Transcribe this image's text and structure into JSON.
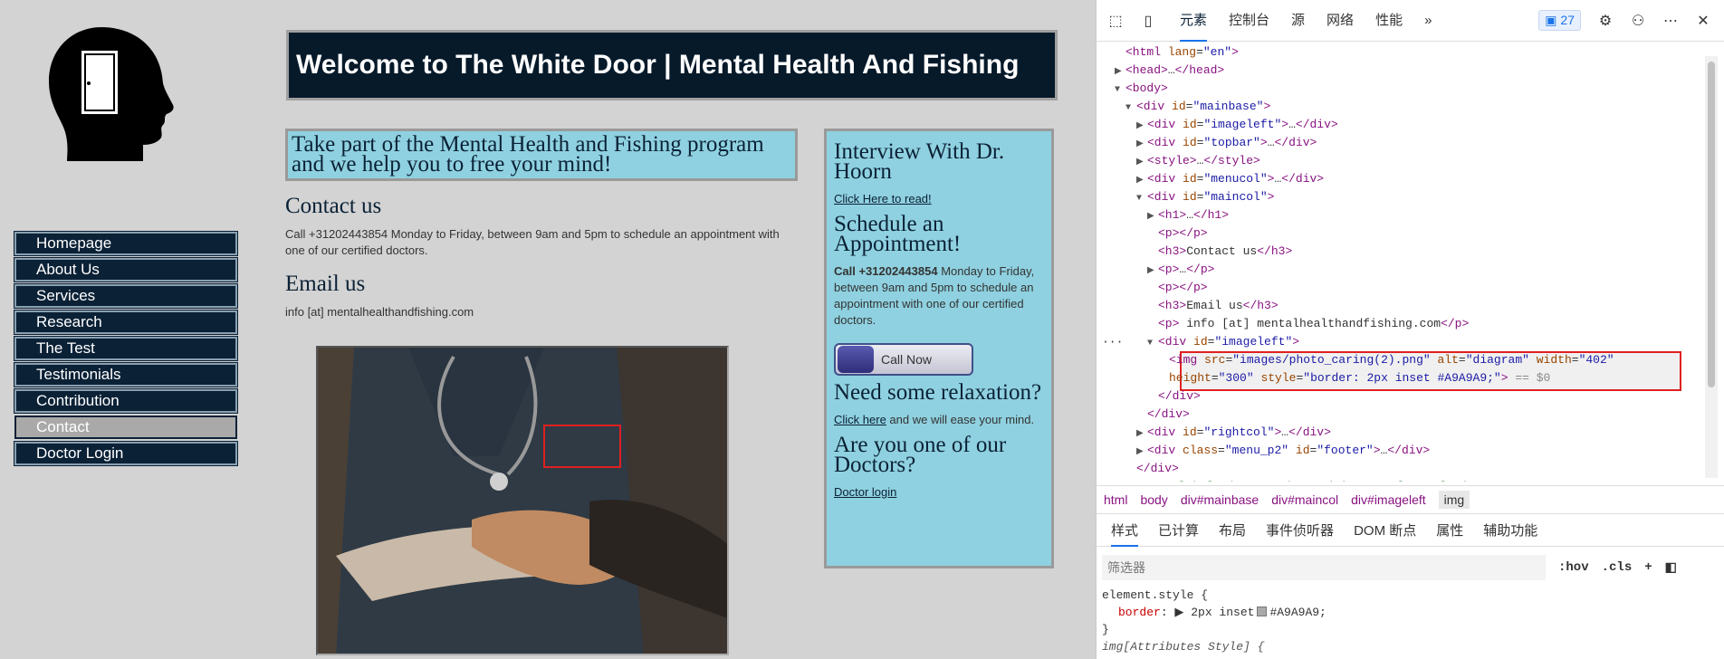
{
  "page": {
    "banner_title": "Welcome to The White Door | Mental Health And Fishing",
    "menu": [
      {
        "label": "Homepage"
      },
      {
        "label": "About Us"
      },
      {
        "label": "Services"
      },
      {
        "label": "Research"
      },
      {
        "label": "The Test"
      },
      {
        "label": "Testimonials"
      },
      {
        "label": "Contribution"
      },
      {
        "label": "Contact",
        "active": true
      },
      {
        "label": "Doctor Login"
      }
    ],
    "intro": "Take part of the Mental Health and Fishing program and we help you to free your mind!",
    "contact_heading": "Contact us",
    "contact_text": "Call +31202443854 Monday to Friday, between 9am and 5pm to schedule an appointment with one of our certified doctors.",
    "email_heading": "Email us",
    "email_text": "info [at] mentalhealthandfishing.com",
    "right": {
      "interview_heading": "Interview With Dr. Hoorn",
      "interview_link": "Click Here to read!",
      "schedule_heading": "Schedule an Appointment!",
      "schedule_phone": "Call +31202443854",
      "schedule_text": " Monday to Friday, between 9am and 5pm to schedule an appointment with one of our certified doctors.",
      "call_now": "Call Now",
      "relax_heading": "Need some relaxation?",
      "relax_link": "Click here",
      "relax_text": " and we will ease your mind.",
      "doctors_heading": "Are you one of our Doctors?",
      "doctors_link": "Doctor login"
    }
  },
  "devtools": {
    "tabs": [
      "元素",
      "控制台",
      "源",
      "网络",
      "性能"
    ],
    "more": "»",
    "issues_count": "27",
    "dom_lines": [
      {
        "indent": 1,
        "html": "<span class='tag'>&lt;html</span> <span class='at'>lang</span>=<span class='av'>\"en\"</span><span class='tag'>&gt;</span>"
      },
      {
        "indent": 1,
        "arrow": "▶",
        "html": "<span class='tag'>&lt;head&gt;</span>…<span class='tag'>&lt;/head&gt;</span>"
      },
      {
        "indent": 1,
        "arrow": "▼",
        "html": "<span class='tag'>&lt;body&gt;</span>"
      },
      {
        "indent": 2,
        "arrow": "▼",
        "html": "<span class='tag'>&lt;div</span> <span class='at'>id</span>=<span class='av'>\"mainbase\"</span><span class='tag'>&gt;</span>"
      },
      {
        "indent": 3,
        "arrow": "▶",
        "html": "<span class='tag'>&lt;div</span> <span class='at'>id</span>=<span class='av'>\"imageleft\"</span><span class='tag'>&gt;</span>…<span class='tag'>&lt;/div&gt;</span>"
      },
      {
        "indent": 3,
        "arrow": "▶",
        "html": "<span class='tag'>&lt;div</span> <span class='at'>id</span>=<span class='av'>\"topbar\"</span><span class='tag'>&gt;</span>…<span class='tag'>&lt;/div&gt;</span>"
      },
      {
        "indent": 3,
        "arrow": "▶",
        "html": "<span class='tag'>&lt;style&gt;</span>…<span class='tag'>&lt;/style&gt;</span>"
      },
      {
        "indent": 3,
        "arrow": "▶",
        "html": "<span class='tag'>&lt;div</span> <span class='at'>id</span>=<span class='av'>\"menucol\"</span><span class='tag'>&gt;</span>…<span class='tag'>&lt;/div&gt;</span>"
      },
      {
        "indent": 3,
        "arrow": "▼",
        "html": "<span class='tag'>&lt;div</span> <span class='at'>id</span>=<span class='av'>\"maincol\"</span><span class='tag'>&gt;</span>"
      },
      {
        "indent": 4,
        "arrow": "▶",
        "html": "<span class='tag'>&lt;h1&gt;</span>…<span class='tag'>&lt;/h1&gt;</span>"
      },
      {
        "indent": 4,
        "html": "<span class='tag'>&lt;p&gt;&lt;/p&gt;</span>"
      },
      {
        "indent": 4,
        "html": "<span class='tag'>&lt;h3&gt;</span>Contact us<span class='tag'>&lt;/h3&gt;</span>"
      },
      {
        "indent": 4,
        "arrow": "▶",
        "html": "<span class='tag'>&lt;p&gt;</span>…<span class='tag'>&lt;/p&gt;</span>"
      },
      {
        "indent": 4,
        "html": "<span class='tag'>&lt;p&gt;&lt;/p&gt;</span>"
      },
      {
        "indent": 4,
        "html": "<span class='tag'>&lt;h3&gt;</span>Email us<span class='tag'>&lt;/h3&gt;</span>"
      },
      {
        "indent": 4,
        "html": "<span class='tag'>&lt;p&gt;</span> info [at] mentalhealthandfishing.com<span class='tag'>&lt;/p&gt;</span>"
      },
      {
        "indent": 4,
        "arrow": "▼",
        "html": "<span class='tag'>&lt;div</span> <span class='at'>id</span>=<span class='av'>\"imageleft\"</span><span class='tag'>&gt;</span>"
      },
      {
        "indent": 5,
        "sel": true,
        "html": "<span class='tag'>&lt;img</span> <span class='at'>src</span>=<span class='av'>\"images/photo_caring(2).png\"</span> <span class='at'>alt</span>=<span class='av'>\"diagram\"</span> <span class='at'>width</span>=<span class='av'>\"402\"</span>"
      },
      {
        "indent": 5,
        "sel": true,
        "html": "<span class='at'>height</span>=<span class='av'>\"300\"</span> <span class='at'>style</span>=<span class='av'>\"border: 2px inset #A9A9A9;\"</span><span class='tag'>&gt;</span> <span style='color:#888'>== $0</span>"
      },
      {
        "indent": 4,
        "html": "<span class='tag'>&lt;/div&gt;</span>"
      },
      {
        "indent": 3,
        "html": "<span class='tag'>&lt;/div&gt;</span>"
      },
      {
        "indent": 3,
        "arrow": "▶",
        "html": "<span class='tag'>&lt;div</span> <span class='at'>id</span>=<span class='av'>\"rightcol\"</span><span class='tag'>&gt;</span>…<span class='tag'>&lt;/div&gt;</span>"
      },
      {
        "indent": 3,
        "arrow": "▶",
        "html": "<span class='tag'>&lt;div</span> <span class='at'>class</span>=<span class='av'>\"menu_p2\"</span> <span class='at'>id</span>=<span class='av'>\"footer\"</span><span class='tag'>&gt;</span>…<span class='tag'>&lt;/div&gt;</span>"
      },
      {
        "indent": 2,
        "html": "<span class='tag'>&lt;/div&gt;</span>"
      },
      {
        "indent": 2,
        "html": "<span class='cm'>&lt;!-- Global site tag (gtag.js) - Google Analytics --&gt;</span>"
      }
    ],
    "breadcrumbs": [
      "html",
      "body",
      "div#mainbase",
      "div#maincol",
      "div#imageleft",
      "img"
    ],
    "panel_tabs": [
      "样式",
      "已计算",
      "布局",
      "事件侦听器",
      "DOM 断点",
      "属性",
      "辅助功能"
    ],
    "filter_placeholder": "筛选器",
    "hov": ":hov",
    "cls": ".cls",
    "style_selector": "element.style {",
    "style_prop": "border",
    "style_val": "2px inset",
    "style_color": "#A9A9A9;",
    "style_close": "}",
    "next_rule": "img[Attributes Style] {"
  }
}
